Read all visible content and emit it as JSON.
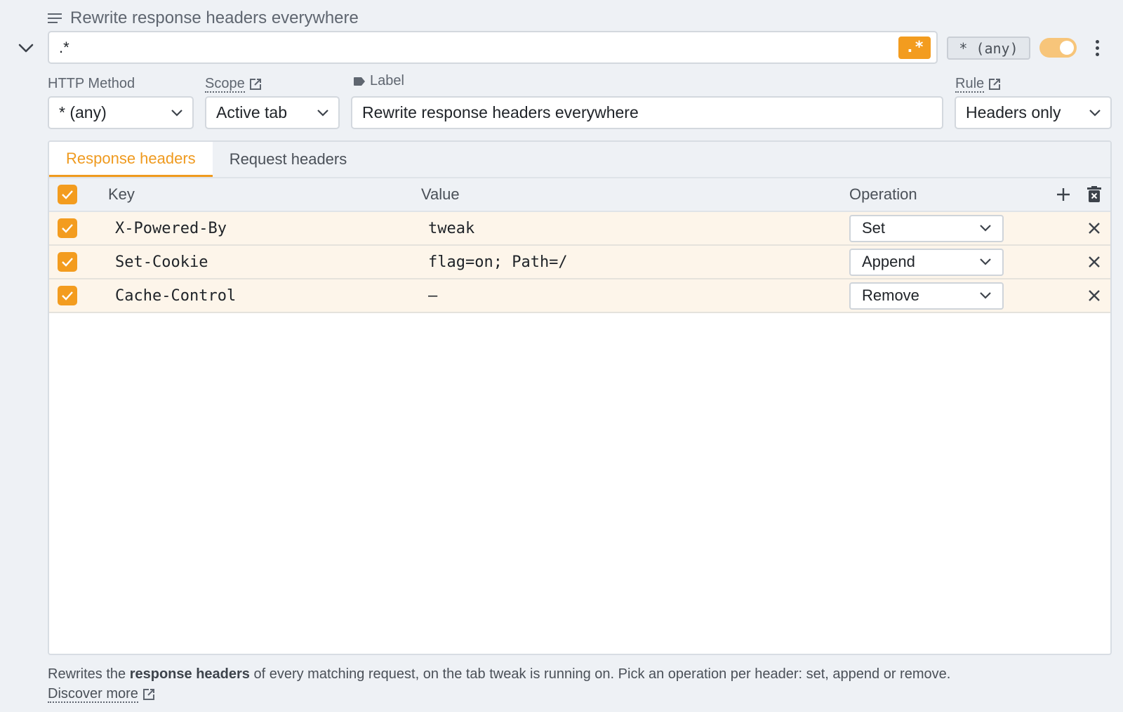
{
  "rule": {
    "title": "Rewrite response headers everywhere",
    "url_pattern": ".*",
    "regex_badge": ".*",
    "method_chip": "* (any)",
    "enabled": true
  },
  "fields": {
    "http_method_label": "HTTP Method",
    "http_method_value": "* (any)",
    "scope_label": "Scope",
    "scope_value": "Active tab",
    "label_label": "Label",
    "label_value": "Rewrite response headers everywhere",
    "rule_label": "Rule",
    "rule_value": "Headers only"
  },
  "tabs": [
    {
      "label": "Response headers",
      "active": true
    },
    {
      "label": "Request headers",
      "active": false
    }
  ],
  "table": {
    "columns": {
      "key": "Key",
      "value": "Value",
      "operation": "Operation"
    },
    "rows": [
      {
        "checked": true,
        "key": "X-Powered-By",
        "value": "tweak",
        "operation": "Set"
      },
      {
        "checked": true,
        "key": "Set-Cookie",
        "value": "flag=on; Path=/",
        "operation": "Append"
      },
      {
        "checked": true,
        "key": "Cache-Control",
        "value": "—",
        "operation": "Remove"
      }
    ]
  },
  "footer": {
    "prefix": "Rewrites the ",
    "bold": "response headers",
    "suffix": " of every matching request, on the tab tweak is running on. Pick an operation per header: set, append or remove.",
    "link": "Discover more"
  },
  "colors": {
    "accent": "#f39c1f",
    "row_bg": "#fdf5ea",
    "page_bg": "#eef1f5"
  }
}
